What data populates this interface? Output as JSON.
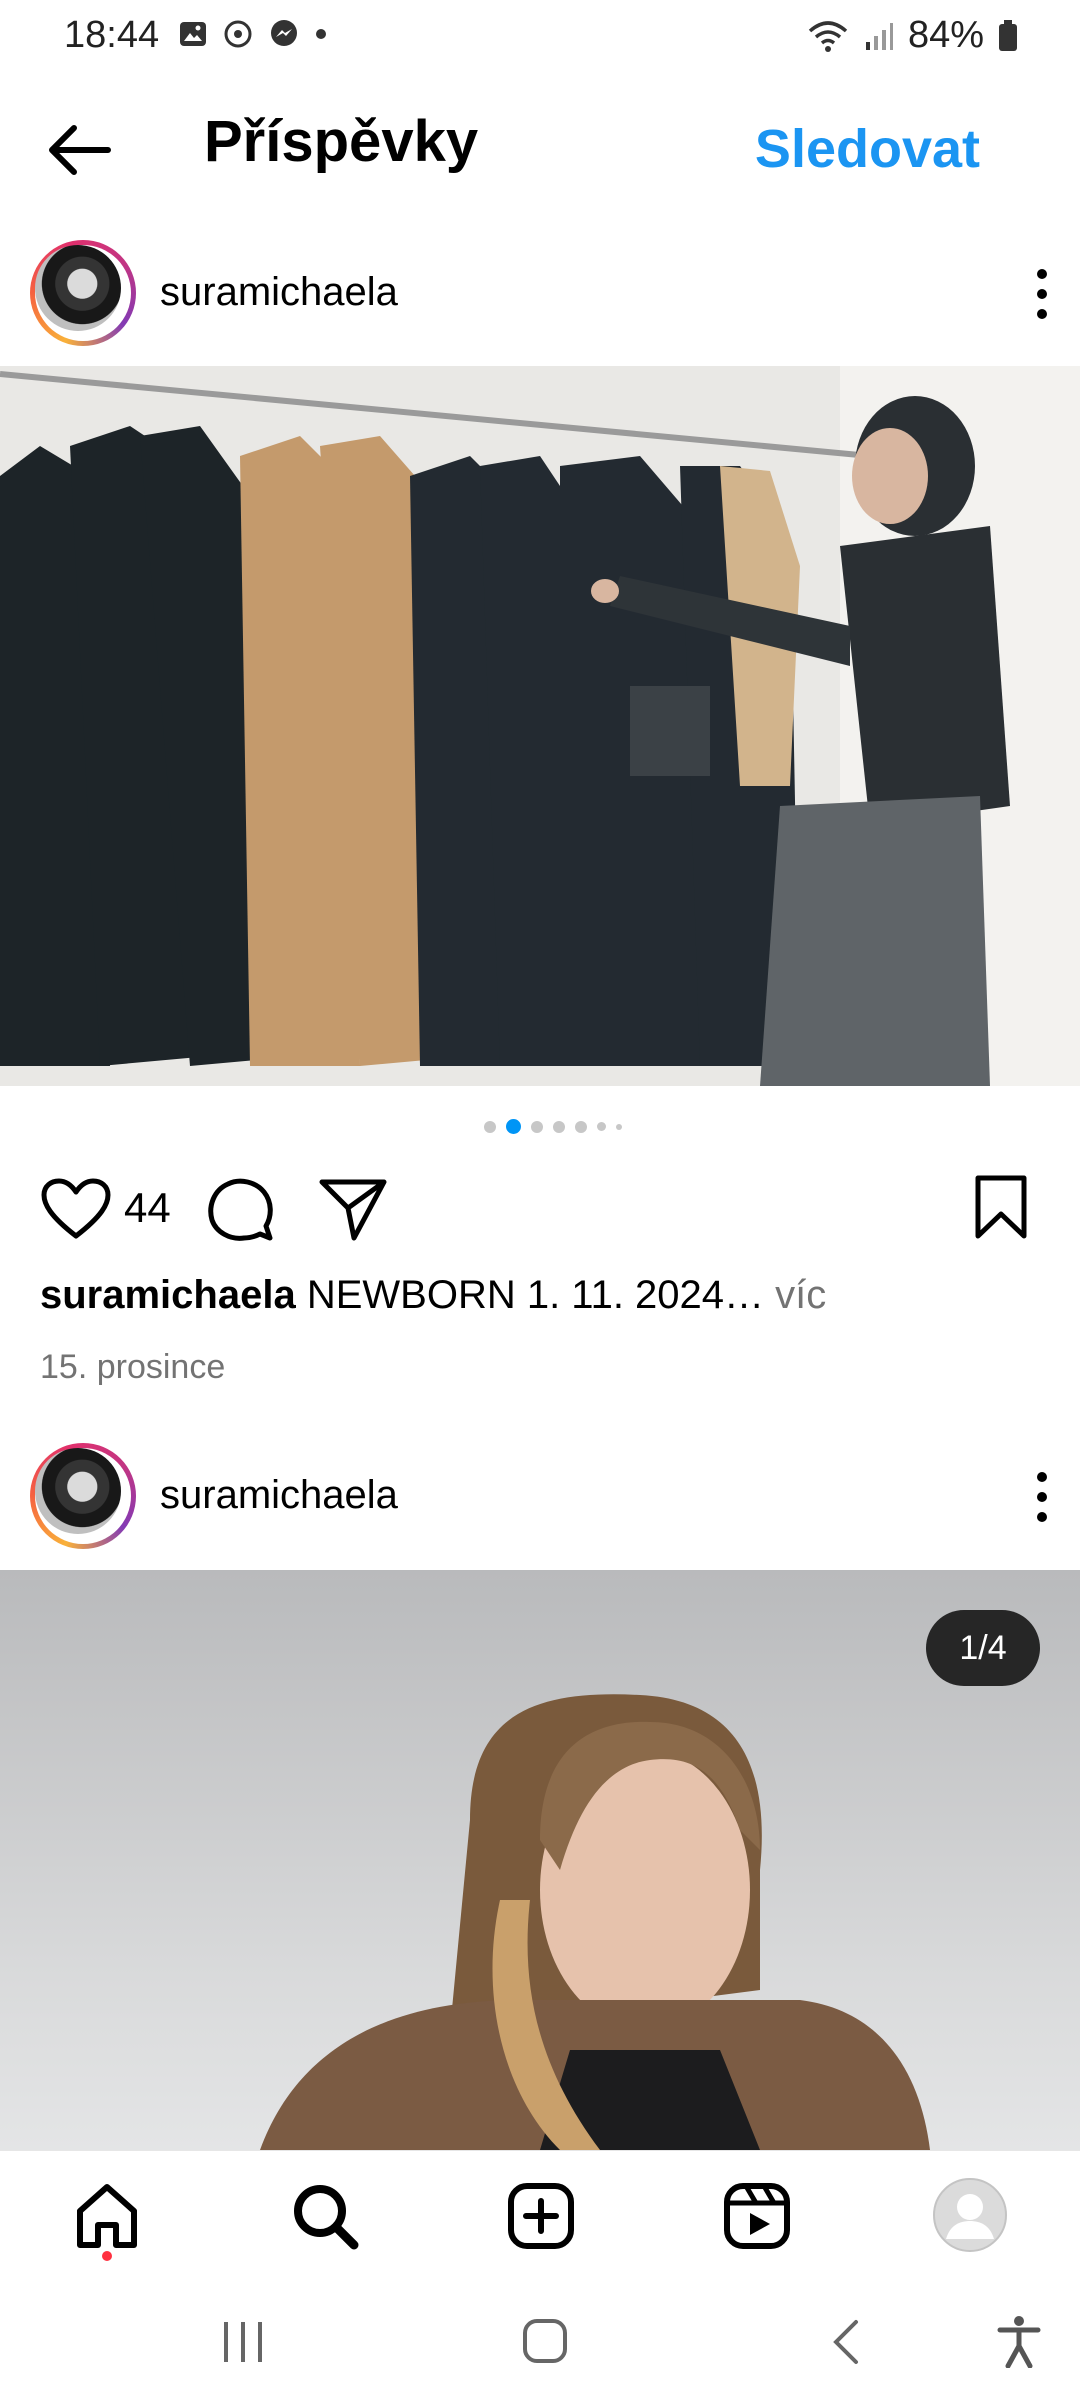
{
  "status_bar": {
    "time": "18:44",
    "battery": "84%"
  },
  "header": {
    "title": "Příspěvky",
    "follow_label": "Sledovat"
  },
  "posts": [
    {
      "username": "suramichaela",
      "likes": "44",
      "caption_user": "suramichaela",
      "caption_text": "NEWBORN 1. 11. 2024…",
      "caption_more": "víc",
      "date": "15. prosince"
    },
    {
      "username": "suramichaela",
      "counter": "1/4"
    }
  ],
  "icons": {
    "back": "arrow-left-icon",
    "more": "kebab-icon",
    "like": "heart-icon",
    "comment": "comment-icon",
    "share": "send-icon",
    "save": "bookmark-icon",
    "home": "home-icon",
    "search": "search-icon",
    "create": "plus-square-icon",
    "reels": "reels-icon",
    "profile": "profile-icon"
  },
  "colors": {
    "accent": "#1b95f2",
    "notification": "#ff3040"
  }
}
